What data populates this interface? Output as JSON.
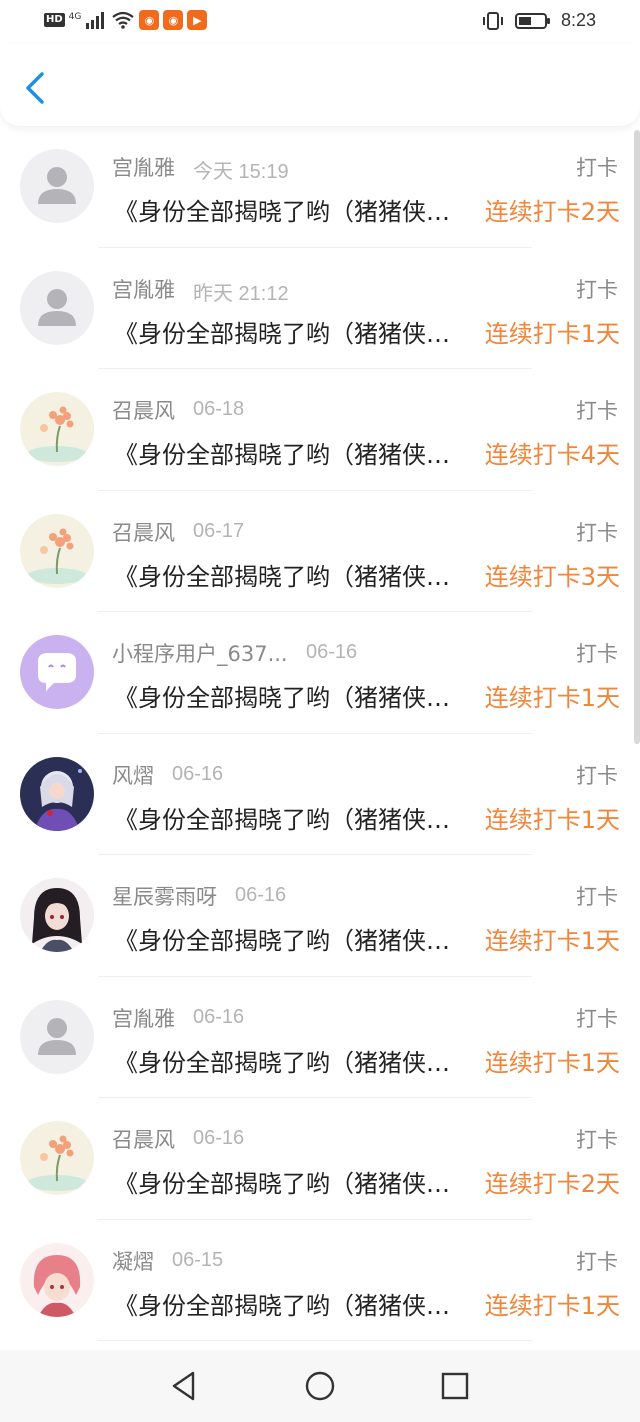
{
  "status_bar": {
    "hd": "HD",
    "network": "4G",
    "time": "8:23",
    "icons": [
      "signal-icon",
      "wifi-icon",
      "app-icon",
      "app-icon",
      "video-app-icon",
      "vibrate-icon",
      "battery-icon"
    ]
  },
  "header": {
    "back_icon": "chevron-left-icon"
  },
  "colors": {
    "accent_blue": "#1e90e8",
    "streak_orange": "#f2853a",
    "muted_gray": "#8a8a8a"
  },
  "list": [
    {
      "name": "宫胤雅",
      "time": "今天 15:19",
      "tag": "打卡",
      "title": "《身份全部揭晓了哟（猪猪侠》打卡",
      "streak": "连续打卡2天",
      "avatar": "default"
    },
    {
      "name": "宫胤雅",
      "time": "昨天 21:12",
      "tag": "打卡",
      "title": "《身份全部揭晓了哟（猪猪侠》打卡",
      "streak": "连续打卡1天",
      "avatar": "default"
    },
    {
      "name": "召晨风",
      "time": "06-18",
      "tag": "打卡",
      "title": "《身份全部揭晓了哟（猪猪侠》打卡",
      "streak": "连续打卡4天",
      "avatar": "flower"
    },
    {
      "name": "召晨风",
      "time": "06-17",
      "tag": "打卡",
      "title": "《身份全部揭晓了哟（猪猪侠》打卡",
      "streak": "连续打卡3天",
      "avatar": "flower"
    },
    {
      "name": "小程序用户_637...",
      "time": "06-16",
      "tag": "打卡",
      "title": "《身份全部揭晓了哟（猪猪侠》打卡",
      "streak": "连续打卡1天",
      "avatar": "chat"
    },
    {
      "name": "风熠",
      "time": "06-16",
      "tag": "打卡",
      "title": "《身份全部揭晓了哟（猪猪侠》打卡",
      "streak": "连续打卡1天",
      "avatar": "anime-blue"
    },
    {
      "name": "星辰雾雨呀",
      "time": "06-16",
      "tag": "打卡",
      "title": "《身份全部揭晓了哟（猪猪侠》打卡",
      "streak": "连续打卡1天",
      "avatar": "anime-dark"
    },
    {
      "name": "宫胤雅",
      "time": "06-16",
      "tag": "打卡",
      "title": "《身份全部揭晓了哟（猪猪侠》打卡",
      "streak": "连续打卡1天",
      "avatar": "default"
    },
    {
      "name": "召晨风",
      "time": "06-16",
      "tag": "打卡",
      "title": "《身份全部揭晓了哟（猪猪侠》打卡",
      "streak": "连续打卡2天",
      "avatar": "flower"
    },
    {
      "name": "凝熠",
      "time": "06-15",
      "tag": "打卡",
      "title": "《身份全部揭晓了哟（猪猪侠》打卡",
      "streak": "连续打卡1天",
      "avatar": "anime-pink"
    }
  ],
  "navbar": {
    "icons": [
      "nav-back-icon",
      "nav-home-icon",
      "nav-recents-icon"
    ]
  }
}
